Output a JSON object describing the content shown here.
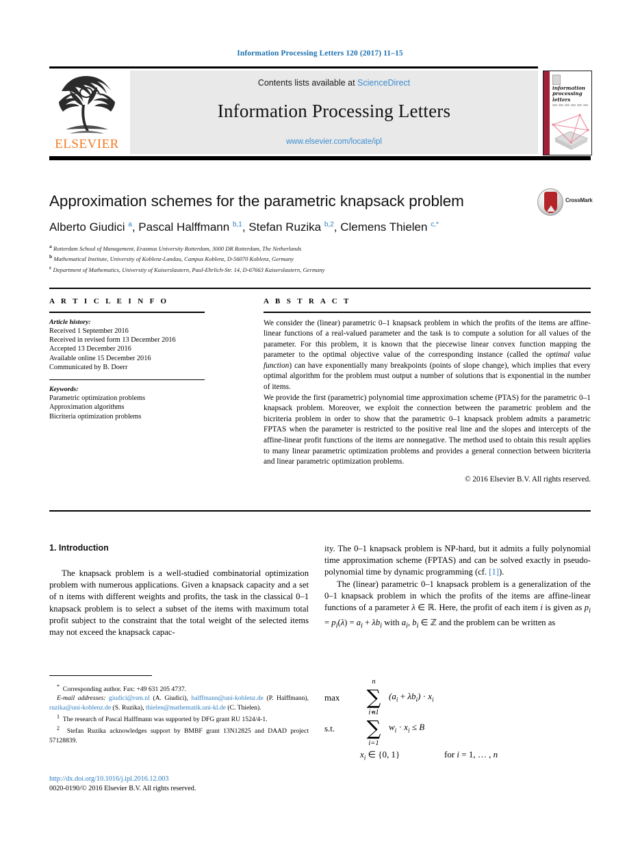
{
  "running_head": "Information Processing Letters 120 (2017) 11–15",
  "masthead": {
    "contents_prefix": "Contents lists available at ",
    "contents_link": "ScienceDirect",
    "journal_title": "Information Processing Letters",
    "journal_url": "www.elsevier.com/locate/ipl",
    "publisher": "ELSEVIER",
    "cover_title": "information processing letters",
    "brand_orange": "#f47920",
    "link_blue": "#3b8dd0",
    "cover_spine_color": "#9e1f38"
  },
  "article": {
    "title": "Approximation schemes for the parametric knapsack problem",
    "authors_html": "Alberto Giudici <sup>a</sup>, Pascal Halffmann <sup>b,1</sup>, Stefan Ruzika <sup>b,2</sup>, Clemens Thielen <sup>c,*</sup>",
    "crossmark_label": "CrossMark",
    "affiliations": [
      {
        "mark": "a",
        "text": "Rotterdam School of Management, Erasmus University Rotterdam, 3000 DR Rotterdam, The Netherlands"
      },
      {
        "mark": "b",
        "text": "Mathematical Institute, University of Koblenz-Landau, Campus Koblenz, D-56070 Koblenz, Germany"
      },
      {
        "mark": "c",
        "text": "Department of Mathematics, University of Kaiserslautern, Paul-Ehrlich-Str. 14, D-67663 Kaiserslautern, Germany"
      }
    ]
  },
  "article_info": {
    "heading": "A R T I C L E    I N F O",
    "history_label": "Article history:",
    "history": [
      "Received 1 September 2016",
      "Received in revised form 13 December 2016",
      "Accepted 13 December 2016",
      "Available online 15 December 2016",
      "Communicated by B. Doerr"
    ],
    "keywords_label": "Keywords:",
    "keywords": [
      "Parametric optimization problems",
      "Approximation algorithms",
      "Bicriteria optimization problems"
    ]
  },
  "abstract": {
    "heading": "A B S T R A C T",
    "para1_a": "We consider the (linear) parametric 0–1 knapsack problem in which the profits of the items are affine-linear functions of a real-valued parameter and the task is to compute a solution for all values of the parameter. For this problem, it is known that the piecewise linear convex function mapping the parameter to the optimal objective value of the corresponding instance (called the ",
    "para1_em": "optimal value function",
    "para1_b": ") can have exponentially many breakpoints (points of slope change), which implies that every optimal algorithm for the problem must output a number of solutions that is exponential in the number of items.",
    "para2": "We provide the first (parametric) polynomial time approximation scheme (PTAS) for the parametric 0–1 knapsack problem. Moreover, we exploit the connection between the parametric problem and the bicriteria problem in order to show that the parametric 0–1 knapsack problem admits a parametric FPTAS when the parameter is restricted to the positive real line and the slopes and intercepts of the affine-linear profit functions of the items are nonnegative. The method used to obtain this result applies to many linear parametric optimization problems and provides a general connection between bicriteria and linear parametric optimization problems.",
    "copyright": "© 2016 Elsevier B.V. All rights reserved."
  },
  "body": {
    "section_heading": "1. Introduction",
    "left_para1": "The knapsack problem is a well-studied combinatorial optimization problem with numerous applications. Given a knapsack capacity and a set of n items with different weights and profits, the task in the classical 0–1 knapsack problem is to select a subset of the items with maximum total profit subject to the constraint that the total weight of the selected items may not exceed the knapsack capac-",
    "right_para1_a": "ity. The 0–1 knapsack problem is NP-hard, but it admits a fully polynomial time approximation scheme (FPTAS) and can be solved exactly in pseudo-polynomial time by dynamic programming (cf. ",
    "right_para1_ref": "[1]",
    "right_para1_b": ").",
    "right_para2": "The (linear) parametric 0–1 knapsack problem is a generalization of the 0–1 knapsack problem in which the profits of the items are affine-linear functions of a parameter λ ∈ ℝ. Here, the profit of each item i is given as p_i = p_i(λ) = a_i + λb_i with a_i, b_i ∈ ℤ and the problem can be written as"
  },
  "math": {
    "max_label": "max",
    "st_label": "s.t.",
    "sum_upper": "n",
    "sum_lower": "i=1",
    "objective": "(a_i + λ b_i) · x_i",
    "constraint": "w_i · x_i ≤ B",
    "binary": "x_i ∈ {0, 1}",
    "range": "for i = 1, … , n"
  },
  "footnotes": {
    "corresponding": "Corresponding author. Fax: +49 631 205 4737.",
    "emails_label": "E-mail addresses:",
    "emails": [
      {
        "addr": "giudici@rsm.nl",
        "name": "(A. Giudici),"
      },
      {
        "addr": "halffmann@uni-koblenz.de",
        "name": "(P. Halffmann),"
      },
      {
        "addr": "ruzika@uni-koblenz.de",
        "name": "(S. Ruzika),"
      },
      {
        "addr": "thielen@mathematik.uni-kl.de",
        "name": "(C. Thielen)."
      }
    ],
    "note1_mark": "1",
    "note1": "The research of Pascal Halffmann was supported by DFG grant RU 1524/4-1.",
    "note2_mark": "2",
    "note2": "Stefan Ruzika acknowledges support by BMBF grant 13N12825 and DAAD project 57128839."
  },
  "doi_block": {
    "doi_url": "http://dx.doi.org/10.1016/j.ipl.2016.12.003",
    "issn_line": "0020-0190/© 2016 Elsevier B.V. All rights reserved."
  }
}
